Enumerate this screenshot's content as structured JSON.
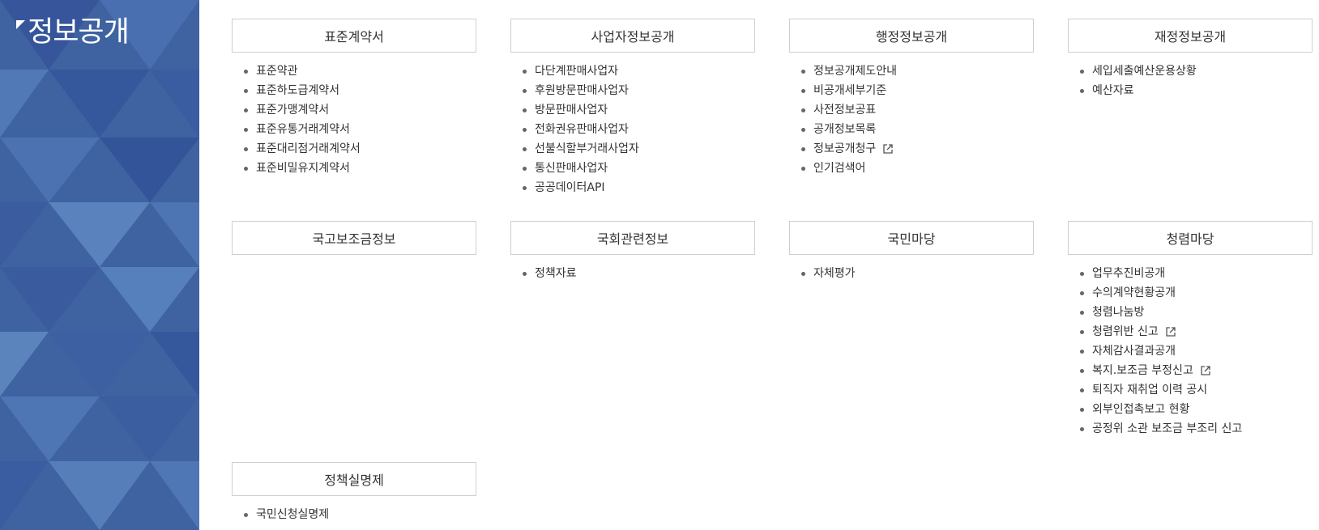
{
  "sidebar": {
    "title": "정보공개"
  },
  "sections": [
    {
      "title": "표준계약서",
      "items": [
        {
          "label": "표준약관"
        },
        {
          "label": "표준하도급계약서"
        },
        {
          "label": "표준가맹계약서"
        },
        {
          "label": "표준유통거래계약서"
        },
        {
          "label": "표준대리점거래계약서"
        },
        {
          "label": "표준비밀유지계약서"
        }
      ]
    },
    {
      "title": "사업자정보공개",
      "items": [
        {
          "label": "다단계판매사업자"
        },
        {
          "label": "후원방문판매사업자"
        },
        {
          "label": "방문판매사업자"
        },
        {
          "label": "전화권유판매사업자"
        },
        {
          "label": "선불식할부거래사업자"
        },
        {
          "label": "통신판매사업자"
        },
        {
          "label": "공공데이터API"
        }
      ]
    },
    {
      "title": "행정정보공개",
      "items": [
        {
          "label": "정보공개제도안내"
        },
        {
          "label": "비공개세부기준"
        },
        {
          "label": "사전정보공표"
        },
        {
          "label": "공개정보목록"
        },
        {
          "label": "정보공개청구",
          "external": true
        },
        {
          "label": "인기검색어"
        }
      ]
    },
    {
      "title": "재정정보공개",
      "items": [
        {
          "label": "세입세출예산운용상황"
        },
        {
          "label": "예산자료"
        }
      ]
    },
    {
      "title": "국고보조금정보",
      "items": []
    },
    {
      "title": "국회관련정보",
      "items": [
        {
          "label": "정책자료"
        }
      ]
    },
    {
      "title": "국민마당",
      "items": [
        {
          "label": "자체평가"
        }
      ]
    },
    {
      "title": "청렴마당",
      "items": [
        {
          "label": "업무추진비공개"
        },
        {
          "label": "수의계약현황공개"
        },
        {
          "label": "청렴나눔방"
        },
        {
          "label": "청렴위반 신고",
          "external": true
        },
        {
          "label": "자체감사결과공개"
        },
        {
          "label": "복지.보조금 부정신고",
          "external": true
        },
        {
          "label": "퇴직자 재취업 이력 공시"
        },
        {
          "label": "외부인접촉보고 현황"
        },
        {
          "label": "공정위 소관 보조금 부조리 신고"
        }
      ]
    },
    {
      "title": "정책실명제",
      "items": [
        {
          "label": "국민신청실명제"
        }
      ]
    }
  ],
  "colors": {
    "sidebar": "#3f62a0",
    "border": "#cfcfcf",
    "text": "#333333"
  }
}
